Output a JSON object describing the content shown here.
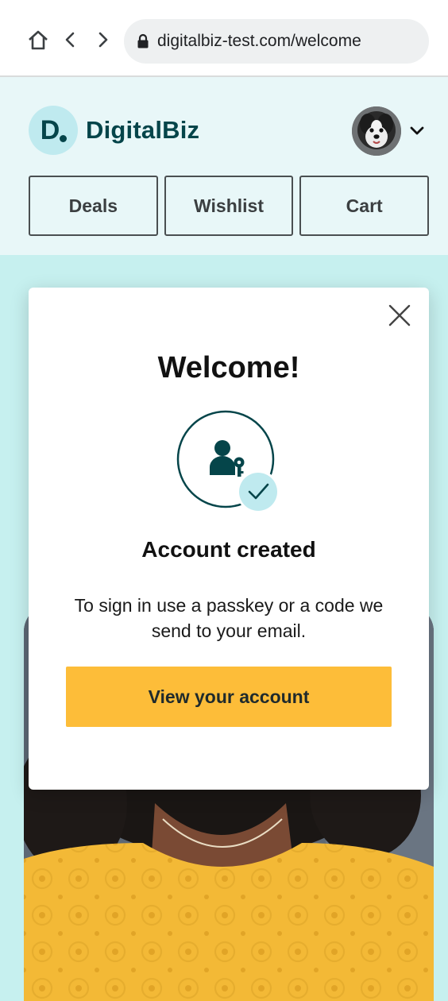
{
  "browser": {
    "url": "digitalbiz-test.com/welcome",
    "icons": {
      "home": "home-icon",
      "back": "chevron-left-icon",
      "forward": "chevron-right-icon",
      "lock": "lock-icon"
    }
  },
  "header": {
    "logo_letter": "D",
    "brand_name": "DigitalBiz",
    "nav": [
      {
        "label": "Deals"
      },
      {
        "label": "Wishlist"
      },
      {
        "label": "Cart"
      }
    ],
    "avatar_icon": "dog-avatar",
    "menu_icon": "chevron-down-icon"
  },
  "modal": {
    "title": "Welcome!",
    "heading": "Account created",
    "message": "To sign in use a passkey or a code we send to your email.",
    "button_label": "View your account",
    "icons": {
      "close": "close-icon",
      "status": "user-passkey-icon",
      "badge": "check-icon"
    }
  },
  "colors": {
    "brand": "#05454a",
    "header_bg": "#e8f7f8",
    "page_bg": "#c6f0ef",
    "accent": "#fdbd39",
    "badge_bg": "#bfeaef"
  }
}
